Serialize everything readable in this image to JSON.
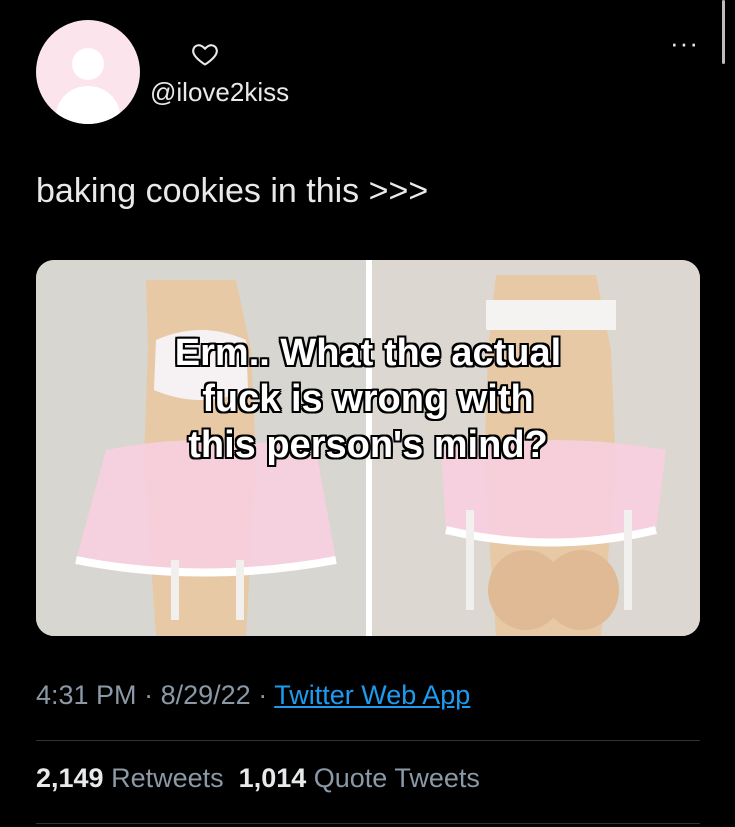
{
  "profile": {
    "handle": "@ilove2kiss"
  },
  "tweet": {
    "text": "baking cookies in this >>>",
    "image_caption": [
      "Erm.. What the actual",
      "fuck is wrong with",
      "this person's mind?"
    ],
    "time": "4:31 PM",
    "date": "8/29/22",
    "separator": "·",
    "source": "Twitter Web App"
  },
  "stats": {
    "retweets_count": "2,149",
    "retweets_label": "Retweets",
    "quotes_count": "1,014",
    "quotes_label": "Quote Tweets"
  },
  "icons": {
    "avatar": "default-avatar-icon",
    "heart": "heart-icon",
    "more": "more-options-icon"
  },
  "colors": {
    "background": "#000000",
    "text": "#e7e9ea",
    "muted": "#8b98a5",
    "link": "#1d9bf0",
    "avatar_bg": "#fbe4ec"
  }
}
